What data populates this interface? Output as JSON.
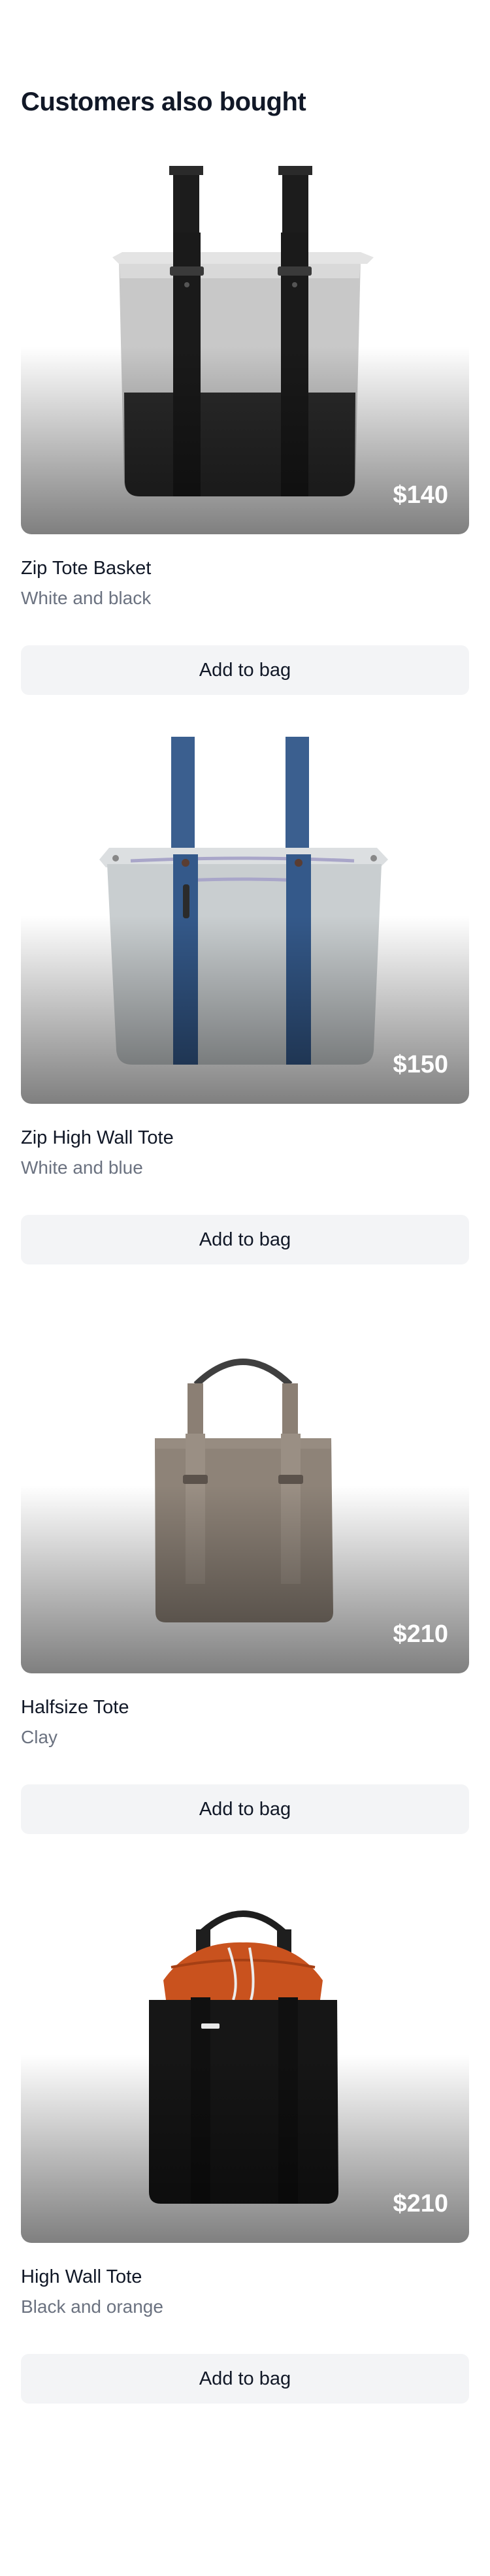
{
  "section": {
    "title": "Customers also bought"
  },
  "products": [
    {
      "name": "Zip Tote Basket",
      "variant": "White and black",
      "price": "$140",
      "button": "Add to bag",
      "image_icon": "zip-tote-basket-image"
    },
    {
      "name": "Zip High Wall Tote",
      "variant": "White and blue",
      "price": "$150",
      "button": "Add to bag",
      "image_icon": "zip-high-wall-tote-image"
    },
    {
      "name": "Halfsize Tote",
      "variant": "Clay",
      "price": "$210",
      "button": "Add to bag",
      "image_icon": "halfsize-tote-image"
    },
    {
      "name": "High Wall Tote",
      "variant": "Black and orange",
      "price": "$210",
      "button": "Add to bag",
      "image_icon": "high-wall-tote-image"
    }
  ],
  "colors": {
    "heading": "#111827",
    "muted_text": "#6b7280",
    "button_bg": "#f3f4f6",
    "price_text": "#ffffff"
  }
}
